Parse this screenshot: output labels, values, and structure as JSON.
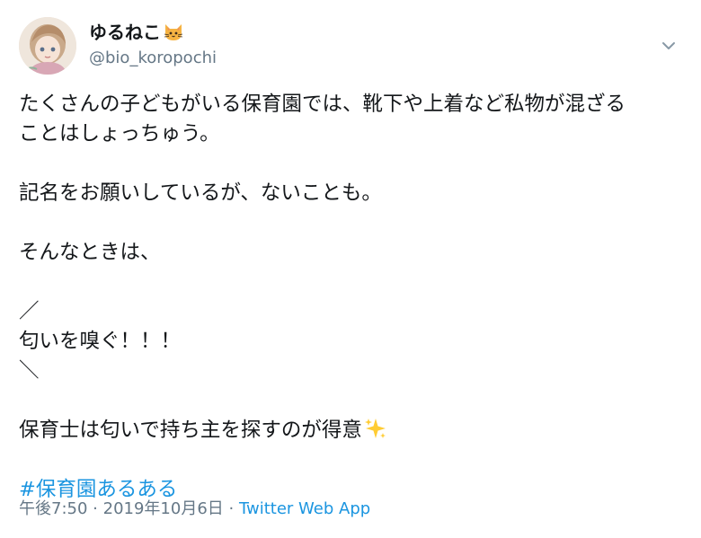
{
  "user": {
    "display_name": "ゆるねこ",
    "name_emoji": "cat-face-emoji",
    "handle": "@bio_koropochi"
  },
  "menu": {
    "icon": "chevron-down-icon"
  },
  "tweet": {
    "lines": [
      "たくさんの子どもがいる保育園では、靴下や上着など私物が混ざる",
      "ことはしょっちゅう。",
      "",
      "記名をお願いしているが、ないことも。",
      "",
      "そんなときは、",
      "",
      "／",
      "匂いを嗅ぐ！！！",
      "＼",
      "",
      "保育士は匂いで持ち主を探すのが得意"
    ],
    "trailing_emoji": "sparkles-emoji",
    "hashtag": "#保育園あるある"
  },
  "meta": {
    "time": "午後7:50",
    "separator": "·",
    "date": "2019年10月6日",
    "source": "Twitter Web App"
  },
  "colors": {
    "text": "#14171a",
    "secondary": "#657786",
    "link": "#1b95e0"
  }
}
